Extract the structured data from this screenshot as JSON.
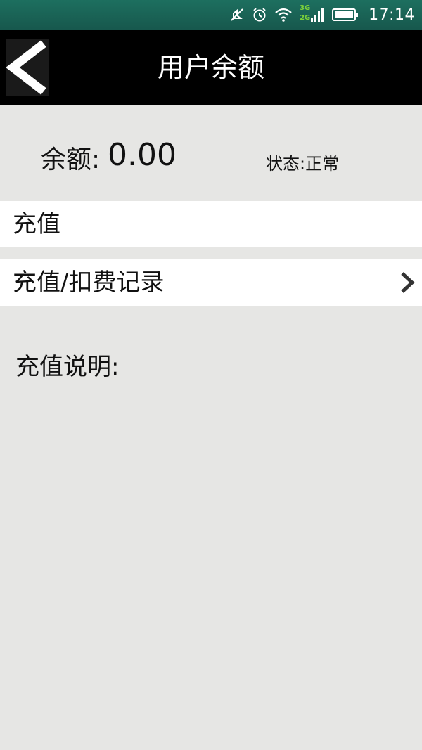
{
  "status_bar": {
    "time": "17:14",
    "net_3g": "3G",
    "net_2g": "2G",
    "icons": [
      "mute-icon",
      "alarm-icon",
      "wifi-icon",
      "signal-icon",
      "battery-icon"
    ]
  },
  "header": {
    "title": "用户余额",
    "back_icon": "back-chevron-icon"
  },
  "balance": {
    "label": "余额:",
    "value": "0.00",
    "status": "状态:正常"
  },
  "menu": {
    "recharge": "充值",
    "records": "充值/扣费记录"
  },
  "explain": {
    "label": "充值说明:"
  },
  "colors": {
    "status_bar": "#1d6f5f",
    "app_bar": "#000000",
    "background": "#e6e6e4",
    "row": "#ffffff",
    "network_badge": "#7cd13a"
  }
}
